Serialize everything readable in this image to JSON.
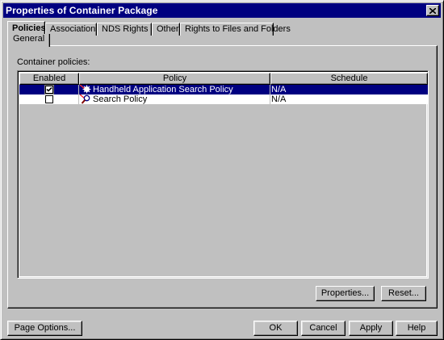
{
  "window": {
    "title": "Properties of Container Package",
    "close_icon": "close-icon"
  },
  "tabs": [
    {
      "label": "Policies",
      "active": true
    },
    {
      "label": "Associations"
    },
    {
      "label": "NDS Rights",
      "has_dropdown": true
    },
    {
      "label": "Other"
    },
    {
      "label": "Rights to Files and Folders"
    }
  ],
  "subtab": {
    "label": "General"
  },
  "panel": {
    "section_label": "Container policies:",
    "columns": [
      "Enabled",
      "Policy",
      "Schedule"
    ],
    "rows": [
      {
        "enabled": true,
        "icon": "handheld-policy-icon",
        "policy": "Handheld Application Search Policy",
        "schedule": "N/A",
        "selected": true
      },
      {
        "enabled": false,
        "icon": "search-policy-icon",
        "policy": "Search Policy",
        "schedule": "N/A",
        "selected": false
      }
    ],
    "buttons": {
      "properties": "Properties...",
      "reset": "Reset..."
    }
  },
  "footer": {
    "page_options": "Page Options...",
    "ok": "OK",
    "cancel": "Cancel",
    "apply": "Apply",
    "help": "Help"
  },
  "colors": {
    "selection": "#000080",
    "face": "#c0c0c0",
    "titlebar": "#000080"
  }
}
